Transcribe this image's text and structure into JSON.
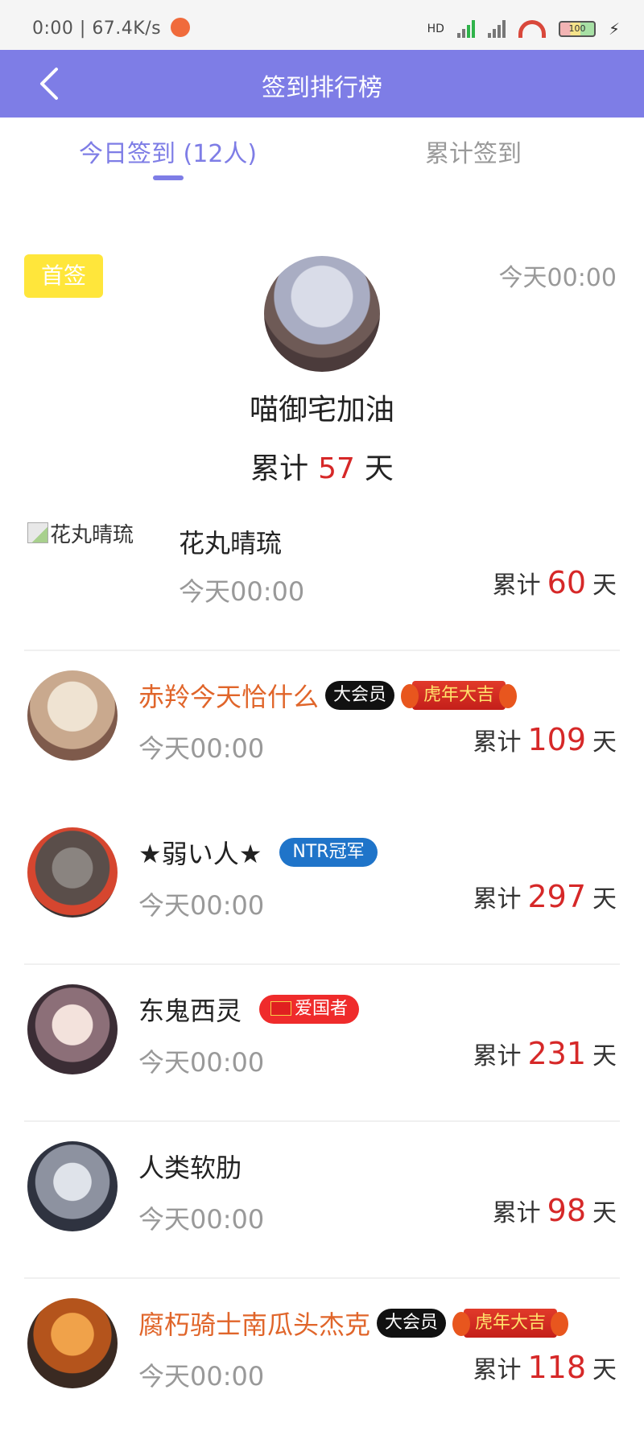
{
  "status_bar": {
    "time": "0:00",
    "speed": "67.4K/s",
    "signal1_label": "HD",
    "battery": "100"
  },
  "header": {
    "title": "签到排行榜"
  },
  "tabs": [
    {
      "label": "今日签到 (12人)",
      "active": true
    },
    {
      "label": "累计签到",
      "active": false
    }
  ],
  "top_entry": {
    "badge": "首签",
    "time": "今天00:00",
    "name": "喵御宅加油",
    "total_prefix": "累计",
    "total_value": "57",
    "total_suffix": "天"
  },
  "rows": [
    {
      "name": "花丸晴琉",
      "avatar_alt": "花丸晴琉",
      "time": "今天00:00",
      "total_prefix": "累计",
      "total_value": "60",
      "total_suffix": "天"
    },
    {
      "name": "赤羚今天恰什么",
      "vip": "大会员",
      "tiger": "虎年大吉",
      "time": "今天00:00",
      "total_prefix": "累计",
      "total_value": "109",
      "total_suffix": "天"
    },
    {
      "name": "★弱い人★",
      "tag": "NTR冠军",
      "time": "今天00:00",
      "total_prefix": "累计",
      "total_value": "297",
      "total_suffix": "天"
    },
    {
      "name": "东鬼西灵",
      "tag": "爱国者",
      "time": "今天00:00",
      "total_prefix": "累计",
      "total_value": "231",
      "total_suffix": "天"
    },
    {
      "name": "人类软肋",
      "time": "今天00:00",
      "total_prefix": "累计",
      "total_value": "98",
      "total_suffix": "天"
    },
    {
      "name": "腐朽骑士南瓜头杰克",
      "vip": "大会员",
      "tiger": "虎年大吉",
      "time": "今天00:00",
      "total_prefix": "累计",
      "total_value": "118",
      "total_suffix": "天"
    }
  ],
  "colors": {
    "accent": "#7e7de6",
    "highlight": "#d62828",
    "vip_name": "#e0652a",
    "first_badge": "#ffe63b"
  }
}
